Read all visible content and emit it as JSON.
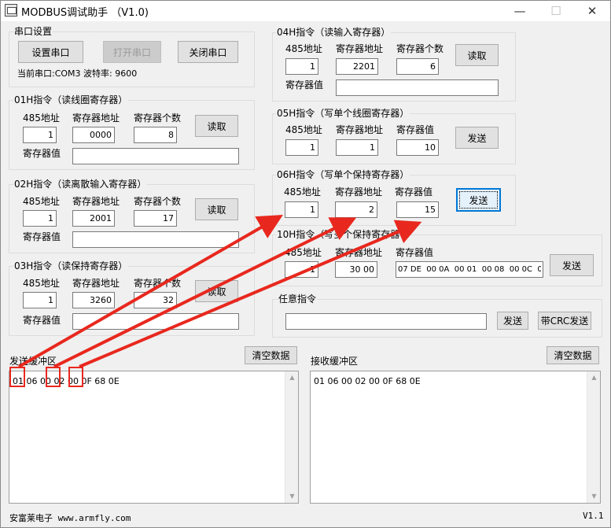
{
  "window": {
    "title": "MODBUS调试助手 （V1.0)",
    "minimize_glyph": "—",
    "maximize_glyph": "☐",
    "close_glyph": "✕",
    "icon": "app-window-icon"
  },
  "serial": {
    "title": "串口设置",
    "setup_label": "设置串口",
    "open_label": "打开串口",
    "close_label": "关闭串口",
    "status": "当前串口:COM3 波特率: 9600"
  },
  "common": {
    "addr485": "485地址",
    "reg_addr": "寄存器地址",
    "reg_count": "寄存器个数",
    "reg_value": "寄存器值",
    "read": "读取",
    "send": "发送"
  },
  "f01": {
    "title": "01H指令（读线圈寄存器）",
    "addr": "1",
    "reg": "0000",
    "count": "8",
    "value": ""
  },
  "f02": {
    "title": "02H指令（读离散输入寄存器）",
    "addr": "1",
    "reg": "2001",
    "count": "17",
    "value": ""
  },
  "f03": {
    "title": "03H指令（读保持寄存器）",
    "addr": "1",
    "reg": "3260",
    "count": "32",
    "value": ""
  },
  "f04": {
    "title": "04H指令（读输入寄存器）",
    "addr": "1",
    "reg": "2201",
    "count": "6",
    "value": ""
  },
  "f05": {
    "title": "05H指令（写单个线圈寄存器）",
    "addr": "1",
    "reg": "1",
    "value": "10"
  },
  "f06": {
    "title": "06H指令（写单个保持寄存器）",
    "addr": "1",
    "reg": "2",
    "value": "15"
  },
  "f10": {
    "title": "10H指令（写多个保持寄存器",
    "addr": "1",
    "reg": "30 00",
    "value": "07 DE  00 0A  00 01  00 08  00 0C  00"
  },
  "custom": {
    "title": "任意指令",
    "value": "",
    "send_label": "发送",
    "crc_send_label": "带CRC发送"
  },
  "send_buffer": {
    "title": "发送缓冲区",
    "clear_label": "清空数据",
    "content": "01 06 00 02 00 0F 68 0E"
  },
  "recv_buffer": {
    "title": "接收缓冲区",
    "clear_label": "清空数据",
    "content": "01 06 00 02 00 0F 68 0E"
  },
  "footer": {
    "company": "安富莱电子 www.armfly.com",
    "version": "V1.1"
  },
  "annotation_color": "#e8281e"
}
